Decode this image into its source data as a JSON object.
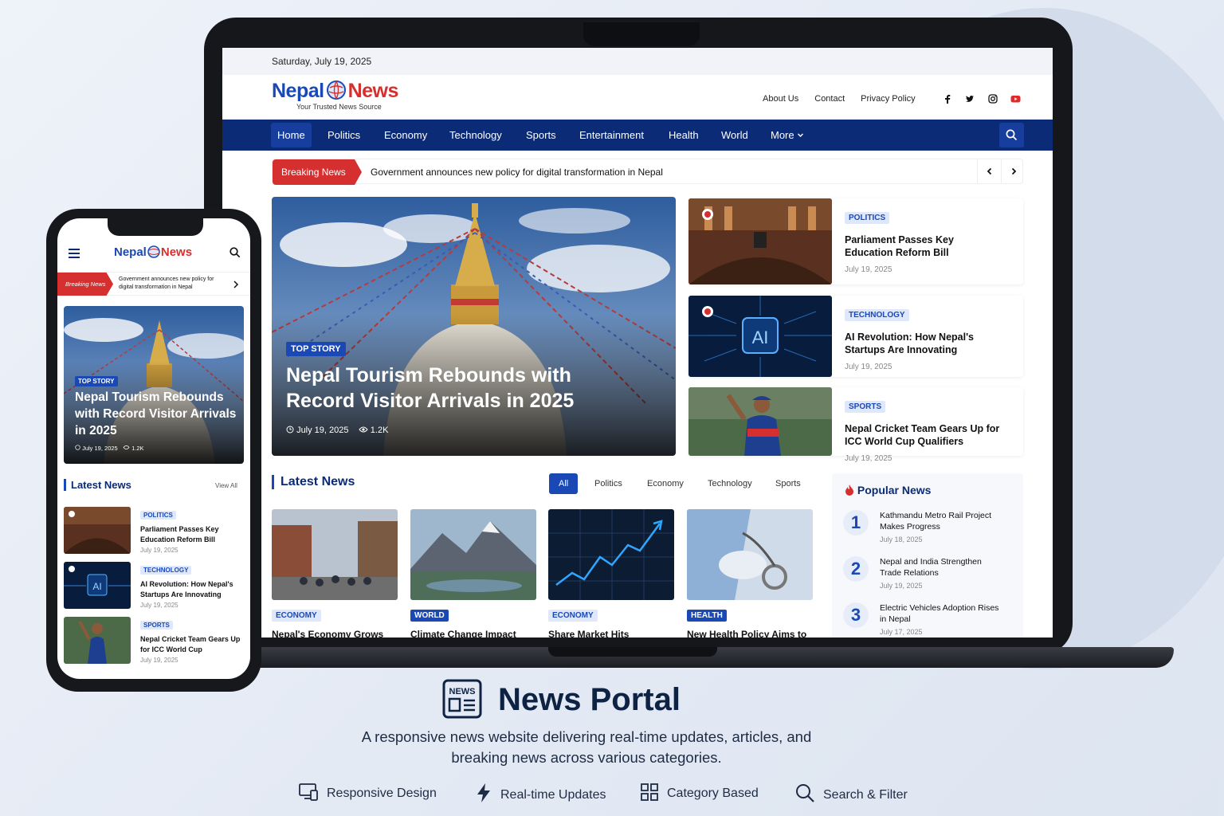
{
  "colors": {
    "brand_blue": "#0b2b77",
    "accent_blue": "#1a49b6",
    "brand_red": "#d62f2f"
  },
  "desktop": {
    "date": "Saturday, July 19, 2025",
    "logo": {
      "part1": "Nepal",
      "part2": "News",
      "tagline": "Your Trusted News Source"
    },
    "top_links": [
      "About Us",
      "Contact",
      "Privacy Policy"
    ],
    "social_icons": [
      "facebook-icon",
      "twitter-icon",
      "instagram-icon",
      "youtube-icon"
    ],
    "nav": [
      "Home",
      "Politics",
      "Economy",
      "Technology",
      "Sports",
      "Entertainment",
      "Health",
      "World",
      "More"
    ],
    "breaking": {
      "label": "Breaking News",
      "text": "Government announces new policy for digital transformation in Nepal"
    },
    "hero": {
      "badge": "TOP STORY",
      "title": "Nepal Tourism Rebounds with Record Visitor Arrivals in 2025",
      "date": "July 19, 2025",
      "views": "1.2K"
    },
    "side_stories": [
      {
        "tag": "POLITICS",
        "title": "Parliament Passes Key Education Reform Bill",
        "date": "July 19, 2025"
      },
      {
        "tag": "TECHNOLOGY",
        "title": "AI Revolution: How Nepal's Startups Are Innovating",
        "date": "July 19, 2025",
        "image_text": "AI"
      },
      {
        "tag": "SPORTS",
        "title": "Nepal Cricket Team Gears Up for ICC World Cup Qualifiers",
        "date": "July 19, 2025"
      }
    ],
    "latest": {
      "title": "Latest News",
      "filters": [
        "All",
        "Politics",
        "Economy",
        "Technology",
        "Sports"
      ],
      "active_filter": "All",
      "cards": [
        {
          "tag": "ECONOMY",
          "title": "Nepal's Economy Grows"
        },
        {
          "tag": "WORLD",
          "title": "Climate Change Impact"
        },
        {
          "tag": "ECONOMY",
          "title": "Share Market Hits"
        },
        {
          "tag": "HEALTH",
          "title": "New Health Policy Aims to"
        }
      ]
    },
    "popular": {
      "title": "Popular News",
      "items": [
        {
          "num": "1",
          "title": "Kathmandu Metro Rail Project Makes Progress",
          "date": "July 18, 2025"
        },
        {
          "num": "2",
          "title": "Nepal and India Strengthen Trade Relations",
          "date": "July 19, 2025"
        },
        {
          "num": "3",
          "title": "Electric Vehicles Adoption Rises in Nepal",
          "date": "July 17, 2025"
        }
      ]
    }
  },
  "mobile": {
    "logo": {
      "part1": "Nepal",
      "part2": "News"
    },
    "breaking": {
      "label": "Breaking News",
      "text": "Government announces new policy for digital transformation in Nepal"
    },
    "hero": {
      "badge": "TOP STORY",
      "title": "Nepal Tourism Rebounds with Record Visitor Arrivals in 2025",
      "date": "July 19, 2025",
      "views": "1.2K"
    },
    "latest_title": "Latest News",
    "view_all": "View All",
    "cards": [
      {
        "tag": "POLITICS",
        "title": "Parliament Passes Key Education Reform Bill",
        "date": "July 19, 2025"
      },
      {
        "tag": "TECHNOLOGY",
        "title": "AI Revolution: How Nepal's Startups Are Innovating",
        "date": "July 19, 2025",
        "image_text": "AI"
      },
      {
        "tag": "SPORTS",
        "title": "Nepal Cricket Team Gears Up for ICC World Cup",
        "date": "July 19, 2025"
      }
    ]
  },
  "branding": {
    "icon_text": "NEWS",
    "title": "News Portal",
    "description": "A responsive news website delivering real-time updates, articles, and breaking news across various categories.",
    "features": [
      {
        "icon": "devices-icon",
        "label": "Responsive Design"
      },
      {
        "icon": "lightning-icon",
        "label": "Real-time Updates"
      },
      {
        "icon": "grid-icon",
        "label": "Category Based"
      },
      {
        "icon": "search-icon",
        "label": "Search & Filter"
      }
    ]
  }
}
